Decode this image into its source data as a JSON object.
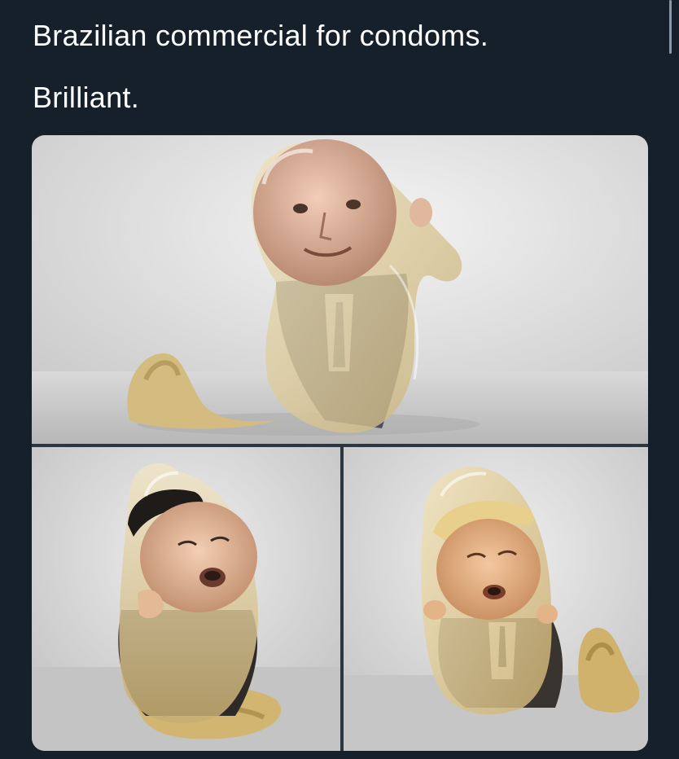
{
  "tweet": {
    "line1": "Brazilian commercial for condoms.",
    "line2": "Brilliant."
  },
  "media": {
    "panels": [
      {
        "id": "top",
        "subject": "condom-caricature-putin"
      },
      {
        "id": "bottom-left",
        "subject": "condom-caricature-kim"
      },
      {
        "id": "bottom-right",
        "subject": "condom-caricature-trump"
      }
    ]
  },
  "colors": {
    "background": "#15202b",
    "text": "#ffffff",
    "studio_backdrop": "#e4e4e4",
    "latex": "#d8c38c"
  }
}
